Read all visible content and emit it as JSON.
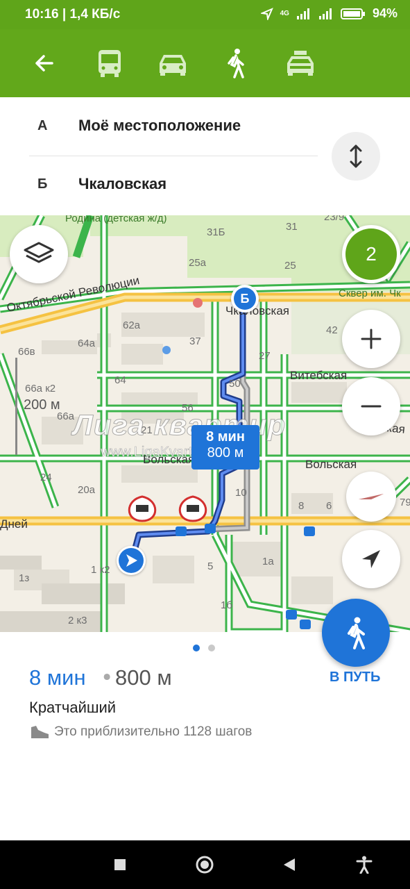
{
  "status_bar": {
    "time": "10:16 | 1,4 КБ/с",
    "network": "4G",
    "battery": "94%"
  },
  "transport_modes": [
    {
      "name": "back-icon"
    },
    {
      "name": "bus-icon"
    },
    {
      "name": "car-icon"
    },
    {
      "name": "walk-icon",
      "selected": true
    },
    {
      "name": "taxi-icon"
    }
  ],
  "route": {
    "from_letter": "А",
    "from": "Моё местоположение",
    "to_letter": "Б",
    "to": "Чкаловская"
  },
  "map": {
    "layers_badge": "2",
    "scale": "200 м",
    "streets": [
      "Октябрьской Революции",
      "Чкаловская",
      "Витебская",
      "Вольская",
      "Вольская",
      "Дней",
      "Сквер им. Чк",
      "Родина (детская ж/д)",
      "Ачинская"
    ],
    "house_numbers": [
      "31Б",
      "31",
      "25а",
      "25",
      "23/9",
      "62а",
      "37",
      "64а",
      "66в",
      "27",
      "42",
      "64",
      "50",
      "66а к2",
      "56",
      "66а",
      "21",
      "24",
      "20а",
      "10",
      "8",
      "6",
      "79",
      "1 к2",
      "1з",
      "5",
      "1а",
      "1б",
      "2 к3"
    ],
    "route_badge": {
      "time": "8 мин",
      "distance": "800 м"
    },
    "pin_label": "Б",
    "watermark": "Лига квартир",
    "watermark_url": "www.LigaKvartir.ru"
  },
  "summary": {
    "time": "8 мин",
    "separator": "•",
    "distance": "800 м",
    "type": "Кратчайший",
    "steps": "Это приблизительно 1128 шагов",
    "go_label": "В ПУТЬ"
  },
  "colors": {
    "header_green": "#62a81b",
    "route_blue": "#1f74d8",
    "traffic_green": "#3cb44b",
    "main_road": "#f5c242"
  }
}
